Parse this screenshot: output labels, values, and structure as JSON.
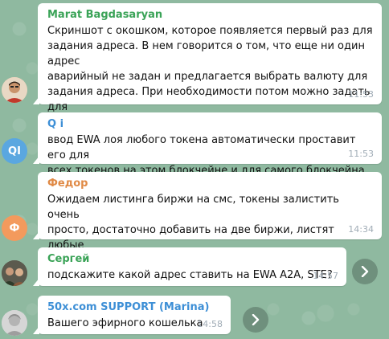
{
  "messages": [
    {
      "sender": "Marat Bagdasaryan",
      "sender_color": "#3aa357",
      "text": "Скриншот с окошком, которое появляется первый раз для\nзадания адреса. В нем говорится о том, что еще ни один адрес\nаварийный не задан и предлагается выбрать  валюту для\nзадания адреса. При необходимости потом можно задать для\nдругих валют, которые используются.",
      "time": "11:53",
      "avatar": "photo"
    },
    {
      "sender": "Q i",
      "sender_color": "#3d8fd6",
      "text": "ввод EWA лоя любого токена автоматически проставит его для\nвсех токенов на этом блокчейне и для самого блокчейна",
      "time": "11:53",
      "avatar_initials": "QI",
      "avatar_color": "#5aa7e0"
    },
    {
      "sender": "Федор",
      "sender_color": "#e08a46",
      "text": "Ожидаем листинга биржи на смс, токены залистить очень\nпросто, достаточно добавить на две биржи, листят любые\nтокены, но главное чтобы добавили саму биржу.",
      "time": "14:34",
      "avatar_initials": "Ф",
      "avatar_color": "#f39a5d"
    },
    {
      "sender": "Сергей",
      "sender_color": "#3aa357",
      "text": "подскажите какой адрес ставить на EWA A2A, STE?",
      "time": "14:57",
      "avatar": "photo"
    },
    {
      "sender": "50x.com SUPPORT (Marina)",
      "sender_color": "#3d8fd6",
      "text": "Вашего эфирного кошелька",
      "time": "14:58",
      "avatar": "photo"
    }
  ]
}
